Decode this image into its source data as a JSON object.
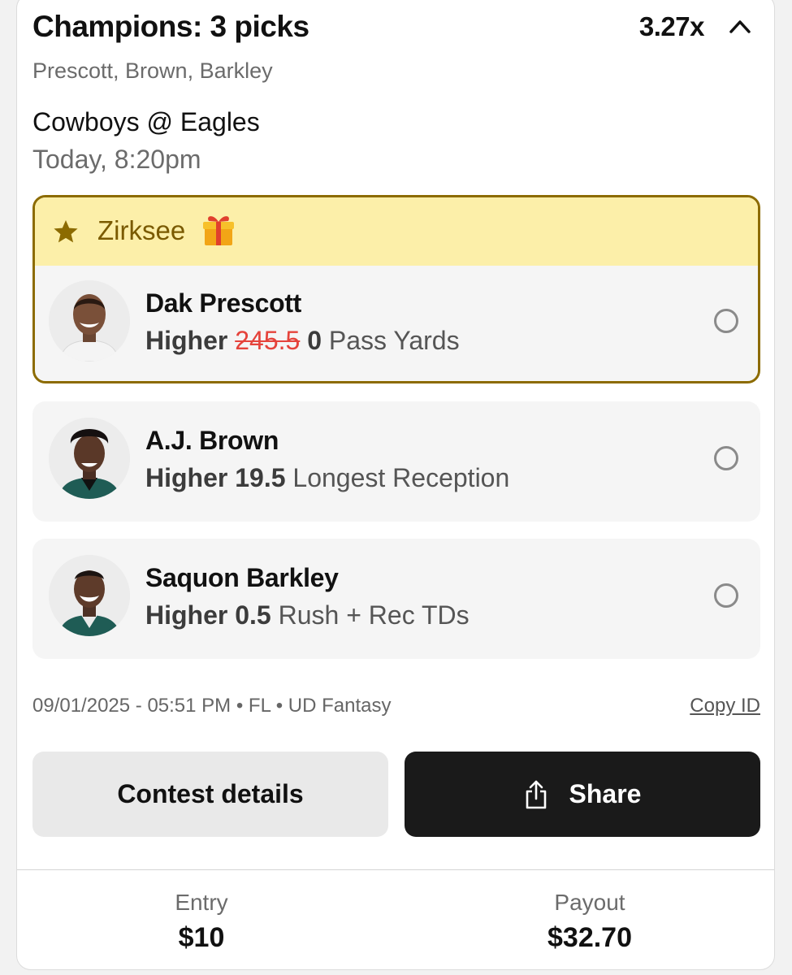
{
  "header": {
    "title": "Champions: 3 picks",
    "multiplier": "3.27x",
    "players_summary": "Prescott, Brown, Barkley"
  },
  "game": {
    "matchup": "Cowboys @ Eagles",
    "time": "Today, 8:20pm"
  },
  "promo": {
    "name": "Zirksee",
    "icon": "gift-icon",
    "accent_color": "#8c6b00",
    "banner_color": "#fcefa9"
  },
  "picks": [
    {
      "player": "Dak Prescott",
      "direction": "Higher",
      "original_line": "245.5",
      "line": "0",
      "stat": "Pass Yards",
      "promo_applied": true
    },
    {
      "player": "A.J. Brown",
      "direction": "Higher",
      "line": "19.5",
      "stat": "Longest Reception",
      "promo_applied": false
    },
    {
      "player": "Saquon Barkley",
      "direction": "Higher",
      "line": "0.5",
      "stat": "Rush + Rec TDs",
      "promo_applied": false
    }
  ],
  "meta": {
    "info": "09/01/2025 - 05:51 PM • FL • UD Fantasy",
    "copy_id": "Copy ID"
  },
  "actions": {
    "details_label": "Contest details",
    "share_label": "Share"
  },
  "footer": {
    "entry_label": "Entry",
    "entry_value": "$10",
    "payout_label": "Payout",
    "payout_value": "$32.70"
  },
  "colors": {
    "strikethrough": "#e5433b",
    "share_button": "#1a1a1a"
  }
}
